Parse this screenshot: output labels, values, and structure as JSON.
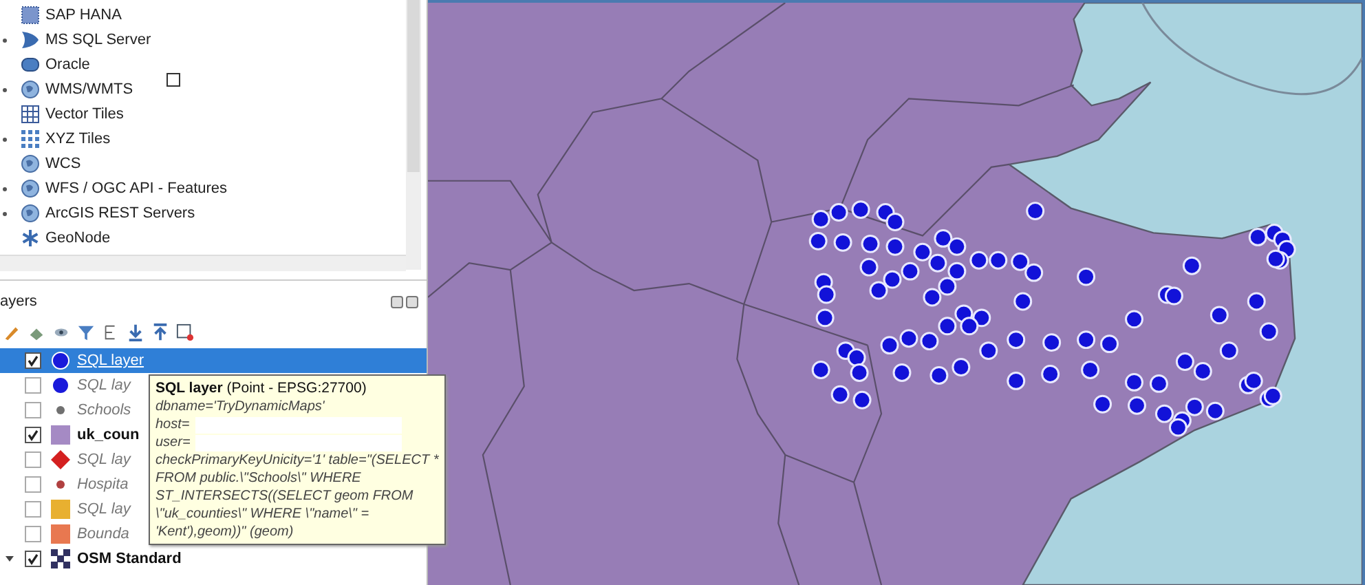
{
  "browser": {
    "items": [
      {
        "label": "SAP HANA",
        "kind": "chip",
        "expandable": false
      },
      {
        "label": "MS SQL Server",
        "kind": "wedge",
        "expandable": true
      },
      {
        "label": "Oracle",
        "kind": "rounded",
        "expandable": false
      },
      {
        "label": "WMS/WMTS",
        "kind": "globe",
        "expandable": true
      },
      {
        "label": "Vector Tiles",
        "kind": "grid",
        "expandable": false
      },
      {
        "label": "XYZ Tiles",
        "kind": "dots",
        "expandable": true
      },
      {
        "label": "WCS",
        "kind": "globe",
        "expandable": false
      },
      {
        "label": "WFS / OGC API - Features",
        "kind": "globe",
        "expandable": true
      },
      {
        "label": "ArcGIS REST Servers",
        "kind": "globe",
        "expandable": true
      },
      {
        "label": "GeoNode",
        "kind": "star",
        "expandable": false
      }
    ]
  },
  "layers": {
    "title": "ayers",
    "items": [
      {
        "label": "SQL layer",
        "checked": true,
        "selected": true,
        "active": true,
        "kind": "circle",
        "color": "#1a1adb",
        "expandable": false
      },
      {
        "label": "SQL lay",
        "checked": false,
        "selected": false,
        "active": false,
        "kind": "circle",
        "color": "#1a1adb",
        "expandable": false
      },
      {
        "label": "Schools",
        "checked": false,
        "selected": false,
        "active": false,
        "kind": "dot",
        "color": "#707070",
        "expandable": false
      },
      {
        "label": "uk_coun",
        "checked": true,
        "selected": false,
        "active": true,
        "kind": "square",
        "color": "#a58ac4",
        "expandable": false
      },
      {
        "label": "SQL lay",
        "checked": false,
        "selected": false,
        "active": false,
        "kind": "diamond",
        "color": "#d42020",
        "expandable": false
      },
      {
        "label": "Hospita",
        "checked": false,
        "selected": false,
        "active": false,
        "kind": "dot",
        "color": "#b04040",
        "expandable": false
      },
      {
        "label": "SQL lay",
        "checked": false,
        "selected": false,
        "active": false,
        "kind": "square",
        "color": "#e8b030",
        "expandable": false
      },
      {
        "label": "Bounda",
        "checked": false,
        "selected": false,
        "active": false,
        "kind": "square",
        "color": "#e87850",
        "expandable": false
      },
      {
        "label": "OSM Standard",
        "checked": true,
        "selected": false,
        "active": true,
        "kind": "tiles",
        "color": "#303060",
        "expandable": true
      }
    ]
  },
  "tooltip": {
    "title": "**SQL layer** (Point - EPSG:27700)",
    "lines": [
      {
        "text": "dbname='TryDynamicMaps'",
        "redacted": false
      },
      {
        "text": "host=",
        "redacted": true
      },
      {
        "text": "user=",
        "redacted": true
      },
      {
        "text": "checkPrimaryKeyUnicity='1' table=\"(SELECT *",
        "redacted": false
      },
      {
        "text": "FROM public.\\\"Schools\\\" WHERE",
        "redacted": false
      },
      {
        "text": "ST_INTERSECTS((SELECT geom FROM",
        "redacted": false
      },
      {
        "text": "\\\"uk_counties\\\" WHERE \\\"name\\\" =",
        "redacted": false
      },
      {
        "text": "'Kent'),geom))\" (geom)",
        "redacted": false
      }
    ]
  }
}
